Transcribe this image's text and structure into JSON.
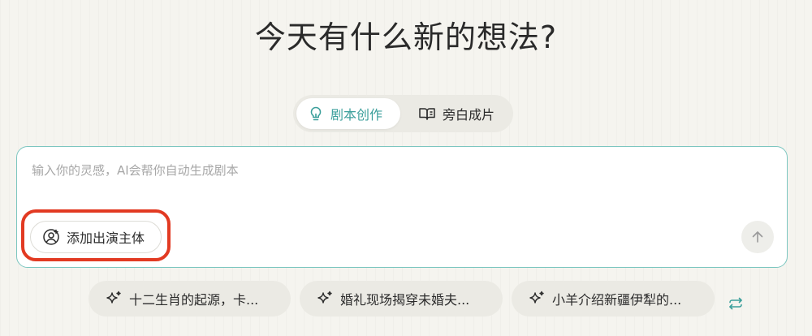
{
  "page": {
    "title": "今天有什么新的想法?"
  },
  "modes": [
    {
      "label": "剧本创作",
      "icon": "lightbulb-icon",
      "active": true
    },
    {
      "label": "旁白成片",
      "icon": "open-book-icon",
      "active": false
    }
  ],
  "prompt": {
    "value": "",
    "placeholder": "输入你的灵感，AI会帮你自动生成剧本",
    "add_cast_label": "添加出演主体",
    "add_cast_icon": "add-person-icon",
    "send_icon": "arrow-up-icon"
  },
  "suggestions": [
    {
      "label": "十二生肖的起源，卡...",
      "icon": "sparkle-icon"
    },
    {
      "label": "婚礼现场揭穿未婚夫...",
      "icon": "sparkle-icon"
    },
    {
      "label": "小羊介绍新疆伊犁的...",
      "icon": "sparkle-icon"
    }
  ],
  "refresh_icon": "refresh-icon",
  "colors": {
    "accent": "#3b9f9b",
    "highlight": "#e23a22",
    "background": "#f5f4ef",
    "border": "#7cc6c0"
  }
}
